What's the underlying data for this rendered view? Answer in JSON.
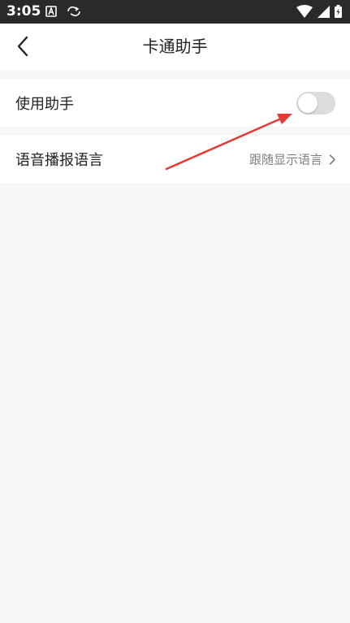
{
  "status_bar": {
    "time": "3:05",
    "icons": [
      "a-notification-icon",
      "sync-icon",
      "wifi-icon",
      "signal-icon",
      "battery-icon"
    ]
  },
  "header": {
    "title": "卡通助手",
    "back_icon": "chevron-left-icon"
  },
  "settings": {
    "assistant": {
      "label": "使用助手",
      "enabled": false
    },
    "voice_language": {
      "label": "语音播报语言",
      "value": "跟随显示语言",
      "chevron_icon": "chevron-right-icon"
    }
  },
  "annotation": {
    "arrow_color": "#e53935"
  },
  "colors": {
    "status_bar_bg": "#2a2a2a",
    "page_bg": "#f7f7f7",
    "row_bg": "#ffffff",
    "toggle_off": "#dcdcdc",
    "secondary_text": "#808080"
  }
}
